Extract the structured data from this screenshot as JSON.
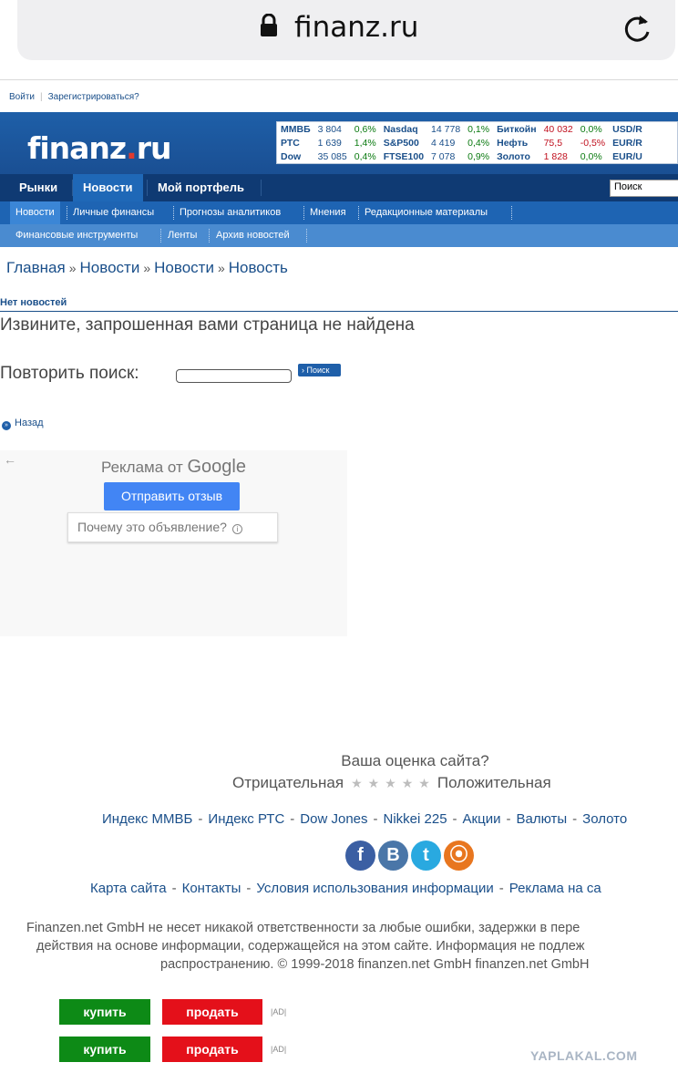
{
  "browser": {
    "url": "finanz.ru"
  },
  "topbar": {
    "login": "Войти",
    "register": "Зарегистрироваться?"
  },
  "logo": {
    "part1": "finanz",
    "dot": ".",
    "part2": "ru"
  },
  "ticker": [
    [
      {
        "name": "ММВБ",
        "val": "3 804",
        "ch": "0,6%",
        "neg": false,
        "red": false
      },
      {
        "name": "Nasdaq",
        "val": "14 778",
        "ch": "0,1%",
        "neg": false,
        "red": false
      },
      {
        "name": "Биткойн",
        "val": "40 032",
        "ch": "0,0%",
        "neg": false,
        "red": true
      },
      {
        "name": "USD/R",
        "val": "",
        "ch": "",
        "neg": false,
        "red": false
      }
    ],
    [
      {
        "name": "РТС",
        "val": "1 639",
        "ch": "1,4%",
        "neg": false,
        "red": false
      },
      {
        "name": "S&P500",
        "val": "4 419",
        "ch": "0,4%",
        "neg": false,
        "red": false
      },
      {
        "name": "Нефть",
        "val": "75,5",
        "ch": "-0,5%",
        "neg": true,
        "red": true
      },
      {
        "name": "EUR/R",
        "val": "",
        "ch": "",
        "neg": false,
        "red": false
      }
    ],
    [
      {
        "name": "Dow",
        "val": "35 085",
        "ch": "0,4%",
        "neg": false,
        "red": false
      },
      {
        "name": "FTSE100",
        "val": "7 078",
        "ch": "0,9%",
        "neg": false,
        "red": false
      },
      {
        "name": "Золото",
        "val": "1 828",
        "ch": "0,0%",
        "neg": false,
        "red": true
      },
      {
        "name": "EUR/U",
        "val": "",
        "ch": "",
        "neg": false,
        "red": false
      }
    ]
  ],
  "nav1": [
    "Рынки",
    "Новости",
    "Мой портфель"
  ],
  "search_placeholder": "Поиск",
  "nav2": [
    "Новости",
    "Личные финансы",
    "Прогнозы аналитиков",
    "Мнения",
    "Редакционные материалы"
  ],
  "nav3": [
    "Финансовые инструменты",
    "Ленты",
    "Архив новостей"
  ],
  "breadcrumb": [
    "Главная",
    "Новости",
    "Новости",
    "Новость"
  ],
  "breadcrumb_sep": "»",
  "section_title": "Нет новостей",
  "not_found": "Извините, запрошенная вами страница не найдена",
  "retry_label": "Повторить поиск:",
  "retry_button": "Поиск",
  "back": "Назад",
  "ad": {
    "title": "Реклама от",
    "brand": "Google",
    "feedback": "Отправить отзыв",
    "why": "Почему это объявление?"
  },
  "rating": {
    "question": "Ваша оценка сайта?",
    "negative": "Отрицательная",
    "positive": "Положительная",
    "stars": "★★★★★"
  },
  "footer_links1": [
    "Индекс ММВБ",
    "Индекс РТС",
    "Dow Jones",
    "Nikkei 225",
    "Акции",
    "Валюты",
    "Золото"
  ],
  "footer_links2": [
    "Карта сайта",
    "Контакты",
    "Условия использования информации",
    "Реклама на са"
  ],
  "disclaimer": [
    "Finanzen.net GmbH не несет никакой ответственности за любые ошибки, задержки в пере",
    "действия на основе информации, содержащейся на этом сайте. Информация не подлеж",
    "распространению. © 1999-2018 finanzen.net GmbH finanzen.net GmbH"
  ],
  "trade": {
    "buy": "купить",
    "sell": "продать",
    "ad_label": "|AD|"
  },
  "watermark": "YAPLAKAL.COM"
}
